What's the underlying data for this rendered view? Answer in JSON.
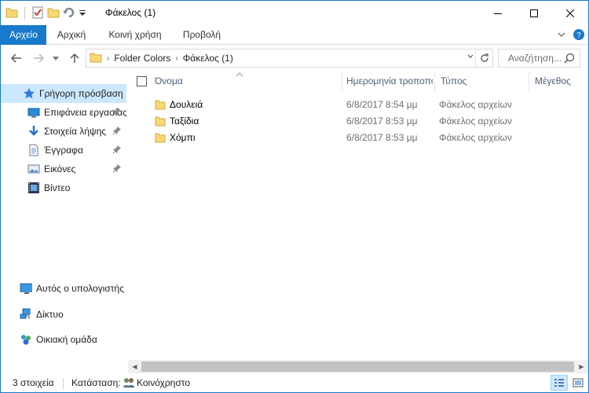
{
  "window": {
    "title": "Φάκελος (1)",
    "accent_color": "#1979ca"
  },
  "ribbon": {
    "tabs": [
      {
        "label": "Αρχείο"
      },
      {
        "label": "Αρχική"
      },
      {
        "label": "Κοινή χρήση"
      },
      {
        "label": "Προβολή"
      }
    ]
  },
  "address": {
    "crumbs": [
      "Folder Colors",
      "Φάκελος (1)"
    ],
    "search_placeholder": "Αναζήτηση..."
  },
  "navpane": {
    "items": [
      {
        "label": "Γρήγορη πρόσβαση",
        "icon": "star-icon",
        "pinned": false,
        "selected": true
      },
      {
        "label": "Επιφάνεια εργασίας",
        "icon": "desktop-icon",
        "pinned": true
      },
      {
        "label": "Στοιχεία λήψης",
        "icon": "download-arrow-icon",
        "pinned": true
      },
      {
        "label": "Έγγραφα",
        "icon": "document-icon",
        "pinned": true
      },
      {
        "label": "Εικόνες",
        "icon": "pictures-icon",
        "pinned": true
      },
      {
        "label": "Βίντεο",
        "icon": "video-icon",
        "pinned": false
      },
      {
        "label": "Αυτός ο υπολογιστής",
        "icon": "computer-icon"
      },
      {
        "label": "Δίκτυο",
        "icon": "network-icon"
      },
      {
        "label": "Οικιακή ομάδα",
        "icon": "homegroup-icon"
      }
    ]
  },
  "columns": [
    {
      "label": "Όνομα"
    },
    {
      "label": "Ημερομηνία τροποποίησης"
    },
    {
      "label": "Τύπος"
    },
    {
      "label": "Μέγεθος"
    }
  ],
  "files": [
    {
      "name": "Δουλειά",
      "date": "6/8/2017 8:54 μμ",
      "type": "Φάκελος αρχείων"
    },
    {
      "name": "Ταξίδια",
      "date": "6/8/2017 8:53 μμ",
      "type": "Φάκελος αρχείων"
    },
    {
      "name": "Χόμπι",
      "date": "6/8/2017 8:53 μμ",
      "type": "Φάκελος αρχείων"
    }
  ],
  "status": {
    "count": "3 στοιχεία",
    "state_label": "Κατάσταση:",
    "state_value": "Κοινόχρηστο"
  }
}
